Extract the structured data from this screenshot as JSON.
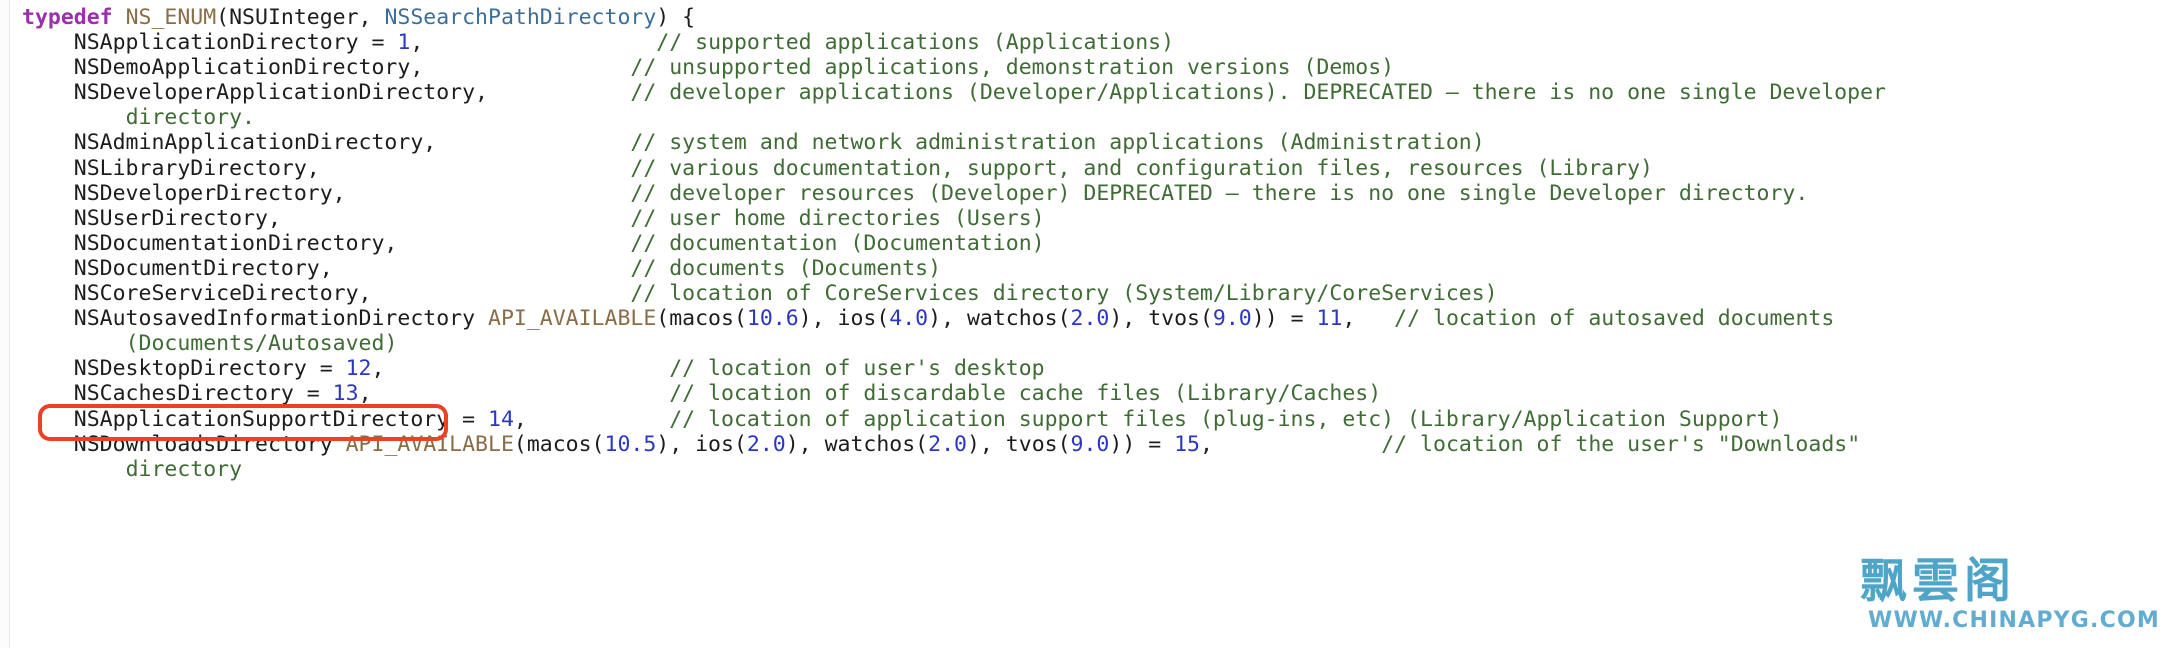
{
  "viewer": {
    "name": "source-code-snippet",
    "language": "objective-c",
    "background_color": "#ffffff",
    "font_size_px": 21.5
  },
  "syntax_colors": {
    "keyword": "#9b2fae",
    "macro": "#8a6c47",
    "type": "#3d6e99",
    "plain": "#1d1d1d",
    "number": "#2b37c4",
    "comment": "#3f6b35"
  },
  "highlight": {
    "name": "red-annotation-box",
    "color": "#ec4126",
    "target_text": "NSApplicationSupportDirectory = 14,",
    "shape": "rounded-rectangle"
  },
  "watermark": {
    "cjk_text": "飘雲阁",
    "url_text": "WWW.CHINAPYG.COM",
    "color": "#3f9ec4"
  },
  "code": {
    "lines": [
      {
        "id": "line-typedef-open",
        "tokens": [
          {
            "t": "keyword",
            "s": "typedef"
          },
          {
            "t": "plain",
            "s": " "
          },
          {
            "t": "macro",
            "s": "NS_ENUM"
          },
          {
            "t": "plain",
            "s": "(NSUInteger, "
          },
          {
            "t": "type",
            "s": "NSSearchPathDirectory"
          },
          {
            "t": "plain",
            "s": ") {"
          }
        ]
      },
      {
        "id": "line-application-directory",
        "tokens": [
          {
            "t": "plain",
            "s": "    NSApplicationDirectory = "
          },
          {
            "t": "number",
            "s": "1"
          },
          {
            "t": "plain",
            "s": ",                  "
          },
          {
            "t": "comment",
            "s": "// supported applications (Applications)"
          }
        ]
      },
      {
        "id": "line-demo-application-directory",
        "tokens": [
          {
            "t": "plain",
            "s": "    NSDemoApplicationDirectory,                "
          },
          {
            "t": "comment",
            "s": "// unsupported applications, demonstration versions (Demos)"
          }
        ]
      },
      {
        "id": "line-developer-application-directory",
        "tokens": [
          {
            "t": "plain",
            "s": "    NSDeveloperApplicationDirectory,           "
          },
          {
            "t": "comment",
            "s": "// developer applications (Developer/Applications). DEPRECATED – there is no one single Developer"
          }
        ]
      },
      {
        "id": "line-developer-application-directory-cont",
        "tokens": [
          {
            "t": "plain",
            "s": "        "
          },
          {
            "t": "comment",
            "s": "directory."
          }
        ]
      },
      {
        "id": "line-admin-application-directory",
        "tokens": [
          {
            "t": "plain",
            "s": "    NSAdminApplicationDirectory,               "
          },
          {
            "t": "comment",
            "s": "// system and network administration applications (Administration)"
          }
        ]
      },
      {
        "id": "line-library-directory",
        "tokens": [
          {
            "t": "plain",
            "s": "    NSLibraryDirectory,                        "
          },
          {
            "t": "comment",
            "s": "// various documentation, support, and configuration files, resources (Library)"
          }
        ]
      },
      {
        "id": "line-developer-directory",
        "tokens": [
          {
            "t": "plain",
            "s": "    NSDeveloperDirectory,                      "
          },
          {
            "t": "comment",
            "s": "// developer resources (Developer) DEPRECATED – there is no one single Developer directory."
          }
        ]
      },
      {
        "id": "line-user-directory",
        "tokens": [
          {
            "t": "plain",
            "s": "    NSUserDirectory,                           "
          },
          {
            "t": "comment",
            "s": "// user home directories (Users)"
          }
        ]
      },
      {
        "id": "line-documentation-directory",
        "tokens": [
          {
            "t": "plain",
            "s": "    NSDocumentationDirectory,                  "
          },
          {
            "t": "comment",
            "s": "// documentation (Documentation)"
          }
        ]
      },
      {
        "id": "line-document-directory",
        "tokens": [
          {
            "t": "plain",
            "s": "    NSDocumentDirectory,                       "
          },
          {
            "t": "comment",
            "s": "// documents (Documents)"
          }
        ]
      },
      {
        "id": "line-core-service-directory",
        "tokens": [
          {
            "t": "plain",
            "s": "    NSCoreServiceDirectory,                    "
          },
          {
            "t": "comment",
            "s": "// location of CoreServices directory (System/Library/CoreServices)"
          }
        ]
      },
      {
        "id": "line-autosaved-information-directory",
        "tokens": [
          {
            "t": "plain",
            "s": "    NSAutosavedInformationDirectory "
          },
          {
            "t": "macro",
            "s": "API_AVAILABLE"
          },
          {
            "t": "plain",
            "s": "(macos("
          },
          {
            "t": "number",
            "s": "10.6"
          },
          {
            "t": "plain",
            "s": "), ios("
          },
          {
            "t": "number",
            "s": "4.0"
          },
          {
            "t": "plain",
            "s": "), watchos("
          },
          {
            "t": "number",
            "s": "2.0"
          },
          {
            "t": "plain",
            "s": "), tvos("
          },
          {
            "t": "number",
            "s": "9.0"
          },
          {
            "t": "plain",
            "s": ")) = "
          },
          {
            "t": "number",
            "s": "11"
          },
          {
            "t": "plain",
            "s": ",   "
          },
          {
            "t": "comment",
            "s": "// location of autosaved documents"
          }
        ]
      },
      {
        "id": "line-autosaved-information-directory-cont",
        "tokens": [
          {
            "t": "plain",
            "s": "        "
          },
          {
            "t": "comment",
            "s": "(Documents/Autosaved)"
          }
        ]
      },
      {
        "id": "line-desktop-directory",
        "tokens": [
          {
            "t": "plain",
            "s": "    NSDesktopDirectory = "
          },
          {
            "t": "number",
            "s": "12"
          },
          {
            "t": "plain",
            "s": ",                      "
          },
          {
            "t": "comment",
            "s": "// location of user's desktop"
          }
        ]
      },
      {
        "id": "line-caches-directory",
        "tokens": [
          {
            "t": "plain",
            "s": "    NSCachesDirectory = "
          },
          {
            "t": "number",
            "s": "13"
          },
          {
            "t": "plain",
            "s": ",                       "
          },
          {
            "t": "comment",
            "s": "// location of discardable cache files (Library/Caches)"
          }
        ]
      },
      {
        "id": "line-application-support-directory",
        "highlighted": true,
        "tokens": [
          {
            "t": "plain",
            "s": "    NSApplicationSupportDirectory = "
          },
          {
            "t": "number",
            "s": "14"
          },
          {
            "t": "plain",
            "s": ",           "
          },
          {
            "t": "comment",
            "s": "// location of application support files (plug-ins, etc) (Library/Application Support)"
          }
        ]
      },
      {
        "id": "line-downloads-directory",
        "tokens": [
          {
            "t": "plain",
            "s": "    NSDownloadsDirectory "
          },
          {
            "t": "macro",
            "s": "API_AVAILABLE"
          },
          {
            "t": "plain",
            "s": "(macos("
          },
          {
            "t": "number",
            "s": "10.5"
          },
          {
            "t": "plain",
            "s": "), ios("
          },
          {
            "t": "number",
            "s": "2.0"
          },
          {
            "t": "plain",
            "s": "), watchos("
          },
          {
            "t": "number",
            "s": "2.0"
          },
          {
            "t": "plain",
            "s": "), tvos("
          },
          {
            "t": "number",
            "s": "9.0"
          },
          {
            "t": "plain",
            "s": ")) = "
          },
          {
            "t": "number",
            "s": "15"
          },
          {
            "t": "plain",
            "s": ",             "
          },
          {
            "t": "comment",
            "s": "// location of the user's \"Downloads\""
          }
        ]
      },
      {
        "id": "line-downloads-directory-cont",
        "tokens": [
          {
            "t": "plain",
            "s": "        "
          },
          {
            "t": "comment",
            "s": "directory"
          }
        ]
      }
    ]
  }
}
